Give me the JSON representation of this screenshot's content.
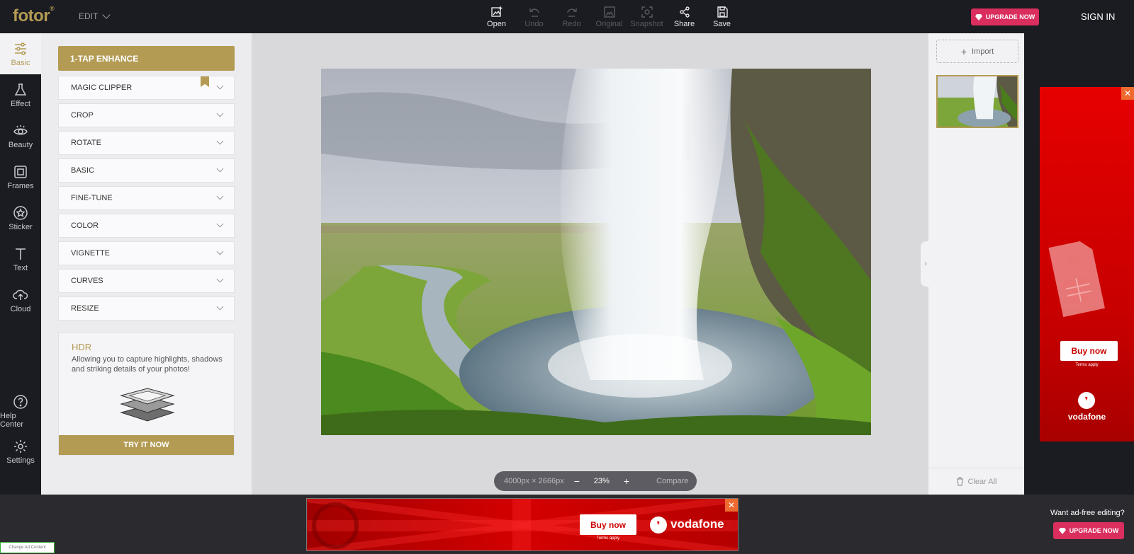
{
  "app": {
    "logo": "fotor",
    "logo_mark": "®",
    "menu_label": "EDIT"
  },
  "toolbar": [
    {
      "label": "Open",
      "icon": "open-image-icon",
      "enabled": true
    },
    {
      "label": "Undo",
      "icon": "undo-icon",
      "enabled": false
    },
    {
      "label": "Redo",
      "icon": "redo-icon",
      "enabled": false
    },
    {
      "label": "Original",
      "icon": "original-icon",
      "enabled": false
    },
    {
      "label": "Snapshot",
      "icon": "snapshot-icon",
      "enabled": false
    },
    {
      "label": "Share",
      "icon": "share-icon",
      "enabled": true
    },
    {
      "label": "Save",
      "icon": "save-icon",
      "enabled": true
    }
  ],
  "header": {
    "upgrade_label": "UPGRADE NOW",
    "signin_label": "SIGN IN"
  },
  "leftnav": [
    {
      "label": "Basic",
      "icon": "sliders-icon",
      "active": true
    },
    {
      "label": "Effect",
      "icon": "flask-icon",
      "active": false
    },
    {
      "label": "Beauty",
      "icon": "eye-icon",
      "active": false
    },
    {
      "label": "Frames",
      "icon": "frame-icon",
      "active": false
    },
    {
      "label": "Sticker",
      "icon": "star-icon",
      "active": false
    },
    {
      "label": "Text",
      "icon": "text-icon",
      "active": false
    },
    {
      "label": "Cloud",
      "icon": "cloud-upload-icon",
      "active": false
    },
    {
      "label": "Help Center",
      "icon": "help-icon",
      "active": false
    },
    {
      "label": "Settings",
      "icon": "gear-icon",
      "active": false
    }
  ],
  "panel": {
    "enhance_label": "1-TAP ENHANCE",
    "items": [
      "MAGIC CLIPPER",
      "CROP",
      "ROTATE",
      "BASIC",
      "FINE-TUNE",
      "COLOR",
      "VIGNETTE",
      "CURVES",
      "RESIZE"
    ],
    "hdr": {
      "title": "HDR",
      "description": "Allowing you to capture highlights, shadows and striking details of your photos!",
      "button_label": "TRY IT NOW"
    }
  },
  "canvas": {
    "dimensions": "4000px × 2666px",
    "zoom_out": "−",
    "zoom": "23%",
    "zoom_in": "+",
    "compare_label": "Compare"
  },
  "rightpanel": {
    "import_label": "Import",
    "import_icon": "+",
    "clear_label": "Clear All"
  },
  "ad_right": {
    "buy_label": "Buy now",
    "terms": "Terms apply",
    "brand": "vodafone",
    "close": "✕"
  },
  "ad_bottom": {
    "buy_label": "Buy now",
    "terms": "Terms apply",
    "brand": "vodafone",
    "close": "✕"
  },
  "footer": {
    "adfree_text": "Want ad-free editing?",
    "upgrade_label": "UPGRADE NOW",
    "change_ad": "Change Ad Content"
  },
  "colors": {
    "accent": "#b39b54",
    "upgrade": "#d92e5e",
    "dark": "#1b1b22",
    "vodafone": "#e60000"
  }
}
